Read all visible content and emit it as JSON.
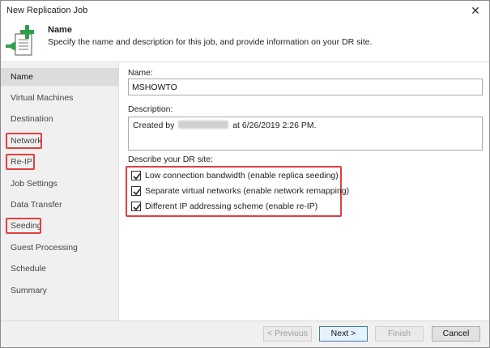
{
  "window": {
    "title": "New Replication Job",
    "close_glyph": "✕"
  },
  "header": {
    "title": "Name",
    "description": "Specify the name and description for this job, and provide information on your DR site.",
    "icon": "new-job-plus-icon"
  },
  "sidebar": {
    "items": [
      {
        "label": "Name",
        "active": true
      },
      {
        "label": "Virtual Machines"
      },
      {
        "label": "Destination"
      },
      {
        "label": "Network",
        "highlighted": true
      },
      {
        "label": "Re-IP",
        "highlighted": true
      },
      {
        "label": "Job Settings"
      },
      {
        "label": "Data Transfer"
      },
      {
        "label": "Seeding",
        "highlighted": true
      },
      {
        "label": "Guest Processing"
      },
      {
        "label": "Schedule"
      },
      {
        "label": "Summary"
      }
    ]
  },
  "form": {
    "name_label": "Name:",
    "name_value": "MSHOWTO",
    "description_label": "Description:",
    "description_prefix": "Created by",
    "description_suffix": "at 6/26/2019 2:26 PM.",
    "dr_label": "Describe your DR site:",
    "options": [
      {
        "label": "Low connection bandwidth (enable replica seeding)",
        "checked": true
      },
      {
        "label": "Separate virtual networks (enable network remapping)",
        "checked": true
      },
      {
        "label": "Different IP addressing scheme (enable re-IP)",
        "checked": true
      }
    ]
  },
  "footer": {
    "previous": "< Previous",
    "next": "Next >",
    "finish": "Finish",
    "cancel": "Cancel"
  },
  "colors": {
    "highlight": "#e04040",
    "icon_green": "#2ea04a"
  }
}
